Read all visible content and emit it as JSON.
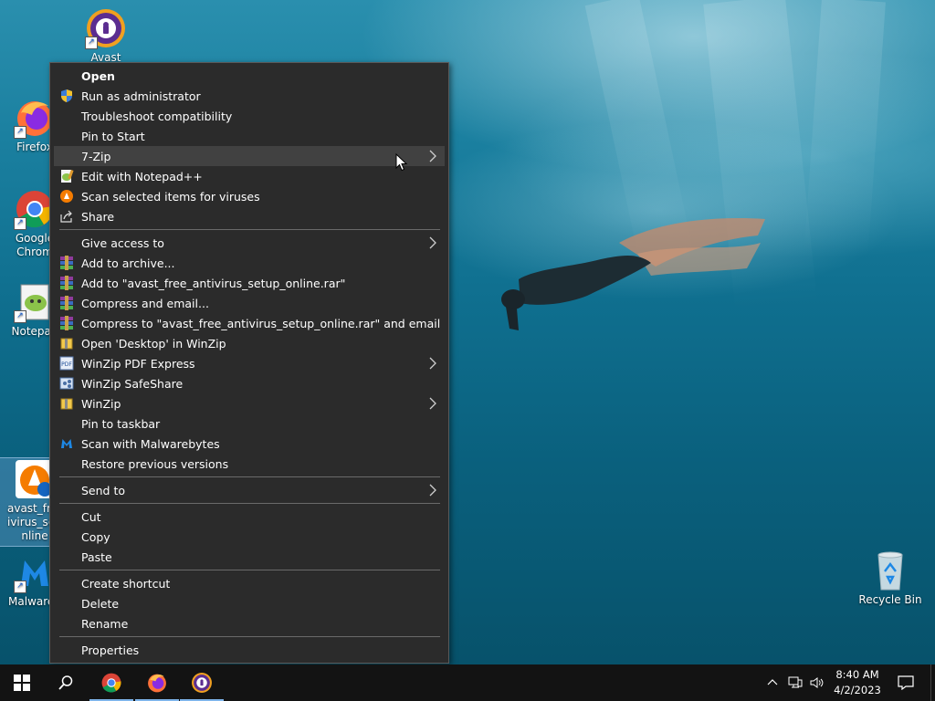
{
  "desktop": {
    "icons": [
      {
        "label": "Avast Secure"
      },
      {
        "label": "Firefox"
      },
      {
        "label": "Google Chrom"
      },
      {
        "label": "Notepad"
      },
      {
        "label": "avast_free ivirus_setu nline"
      },
      {
        "label": "Malwareb"
      },
      {
        "label": "Recycle Bin"
      }
    ]
  },
  "context_menu": {
    "items": [
      {
        "label": "Open"
      },
      {
        "label": "Run as administrator"
      },
      {
        "label": "Troubleshoot compatibility"
      },
      {
        "label": "Pin to Start"
      },
      {
        "label": "7-Zip"
      },
      {
        "label": "Edit with Notepad++"
      },
      {
        "label": "Scan selected items for viruses"
      },
      {
        "label": "Share"
      },
      {
        "label": "Give access to"
      },
      {
        "label": "Add to archive..."
      },
      {
        "label": "Add to \"avast_free_antivirus_setup_online.rar\""
      },
      {
        "label": "Compress and email..."
      },
      {
        "label": "Compress to \"avast_free_antivirus_setup_online.rar\" and email"
      },
      {
        "label": "Open 'Desktop' in WinZip"
      },
      {
        "label": "WinZip PDF Express"
      },
      {
        "label": "WinZip SafeShare"
      },
      {
        "label": "WinZip"
      },
      {
        "label": "Pin to taskbar"
      },
      {
        "label": "Scan with Malwarebytes"
      },
      {
        "label": "Restore previous versions"
      },
      {
        "label": "Send to"
      },
      {
        "label": "Cut"
      },
      {
        "label": "Copy"
      },
      {
        "label": "Paste"
      },
      {
        "label": "Create shortcut"
      },
      {
        "label": "Delete"
      },
      {
        "label": "Rename"
      },
      {
        "label": "Properties"
      }
    ],
    "hovered_item": "7-Zip"
  },
  "taskbar": {
    "clock_time": "8:40 AM",
    "clock_date": "4/2/2023"
  },
  "colors": {
    "menu_bg": "#2b2b2b",
    "menu_hover": "#414141",
    "taskbar_bg": "#131313",
    "accent": "#7eb4ea"
  }
}
